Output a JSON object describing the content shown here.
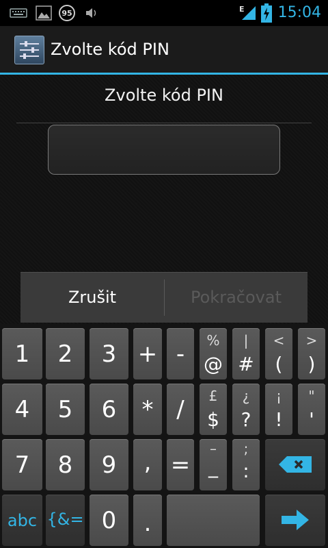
{
  "status_bar": {
    "time": "15:04",
    "notification_badge": "95",
    "network_label": "E",
    "icons": [
      "keyboard-icon",
      "image-icon",
      "badge-95-icon",
      "volume-icon",
      "signal-icon",
      "battery-charging-icon"
    ]
  },
  "action_bar": {
    "title": "Zvolte kód PIN",
    "icon": "settings-sliders-icon"
  },
  "content": {
    "header": "Zvolte kód PIN",
    "pin_value": ""
  },
  "buttons": {
    "cancel": "Zrušit",
    "continue": "Pokračovat"
  },
  "keyboard": {
    "row1": [
      {
        "main": "1"
      },
      {
        "main": "2"
      },
      {
        "main": "3"
      },
      {
        "main": "+"
      },
      {
        "main": "-"
      },
      {
        "top": "%",
        "bottom": "@"
      },
      {
        "top": "|",
        "bottom": "#"
      },
      {
        "top": "<",
        "bottom": "("
      },
      {
        "top": ">",
        "bottom": ")"
      }
    ],
    "row2": [
      {
        "main": "4"
      },
      {
        "main": "5"
      },
      {
        "main": "6"
      },
      {
        "main": "*"
      },
      {
        "main": "/"
      },
      {
        "top": "£",
        "bottom": "$"
      },
      {
        "top": "¿",
        "bottom": "?"
      },
      {
        "top": "¡",
        "bottom": "!"
      },
      {
        "top": "\"",
        "bottom": "'"
      }
    ],
    "row3": [
      {
        "main": "7"
      },
      {
        "main": "8"
      },
      {
        "main": "9"
      },
      {
        "main": ","
      },
      {
        "main": "="
      },
      {
        "top": "–",
        "bottom": "_"
      },
      {
        "top": ";",
        "bottom": ":"
      }
    ],
    "row4": {
      "abc": "abc",
      "symbols": "{&=",
      "zero": "0",
      "period": "."
    },
    "accent": "#33b5e5"
  }
}
